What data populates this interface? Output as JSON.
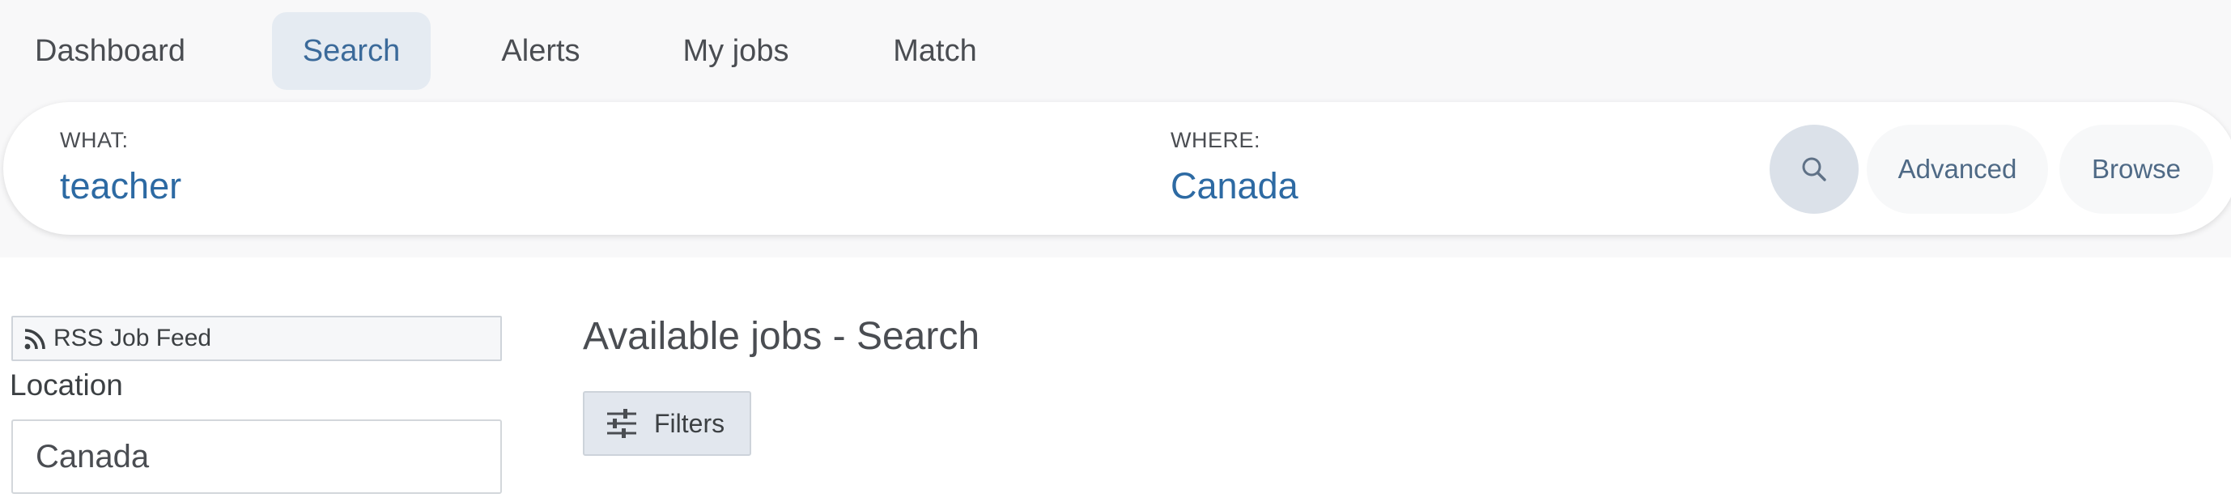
{
  "nav": {
    "tabs": [
      {
        "label": "Dashboard",
        "active": false
      },
      {
        "label": "Search",
        "active": true
      },
      {
        "label": "Alerts",
        "active": false
      },
      {
        "label": "My jobs",
        "active": false
      },
      {
        "label": "Match",
        "active": false
      }
    ]
  },
  "search": {
    "what_label": "WHAT:",
    "what_value": "teacher",
    "where_label": "WHERE:",
    "where_value": "Canada",
    "search_icon": "search-icon",
    "advanced_label": "Advanced",
    "browse_label": "Browse"
  },
  "sidebar": {
    "rss_icon": "rss-icon",
    "rss_label": "RSS Job Feed",
    "location_label": "Location",
    "location_value": "Canada"
  },
  "results": {
    "title": "Available jobs - Search",
    "filters_icon": "sliders-icon",
    "filters_label": "Filters"
  },
  "colors": {
    "accent_text": "#2d6aa3",
    "active_tab_bg": "#e5ebf2",
    "band_bg": "#f8f8f9",
    "search_button_bg": "#dbe1e9"
  }
}
